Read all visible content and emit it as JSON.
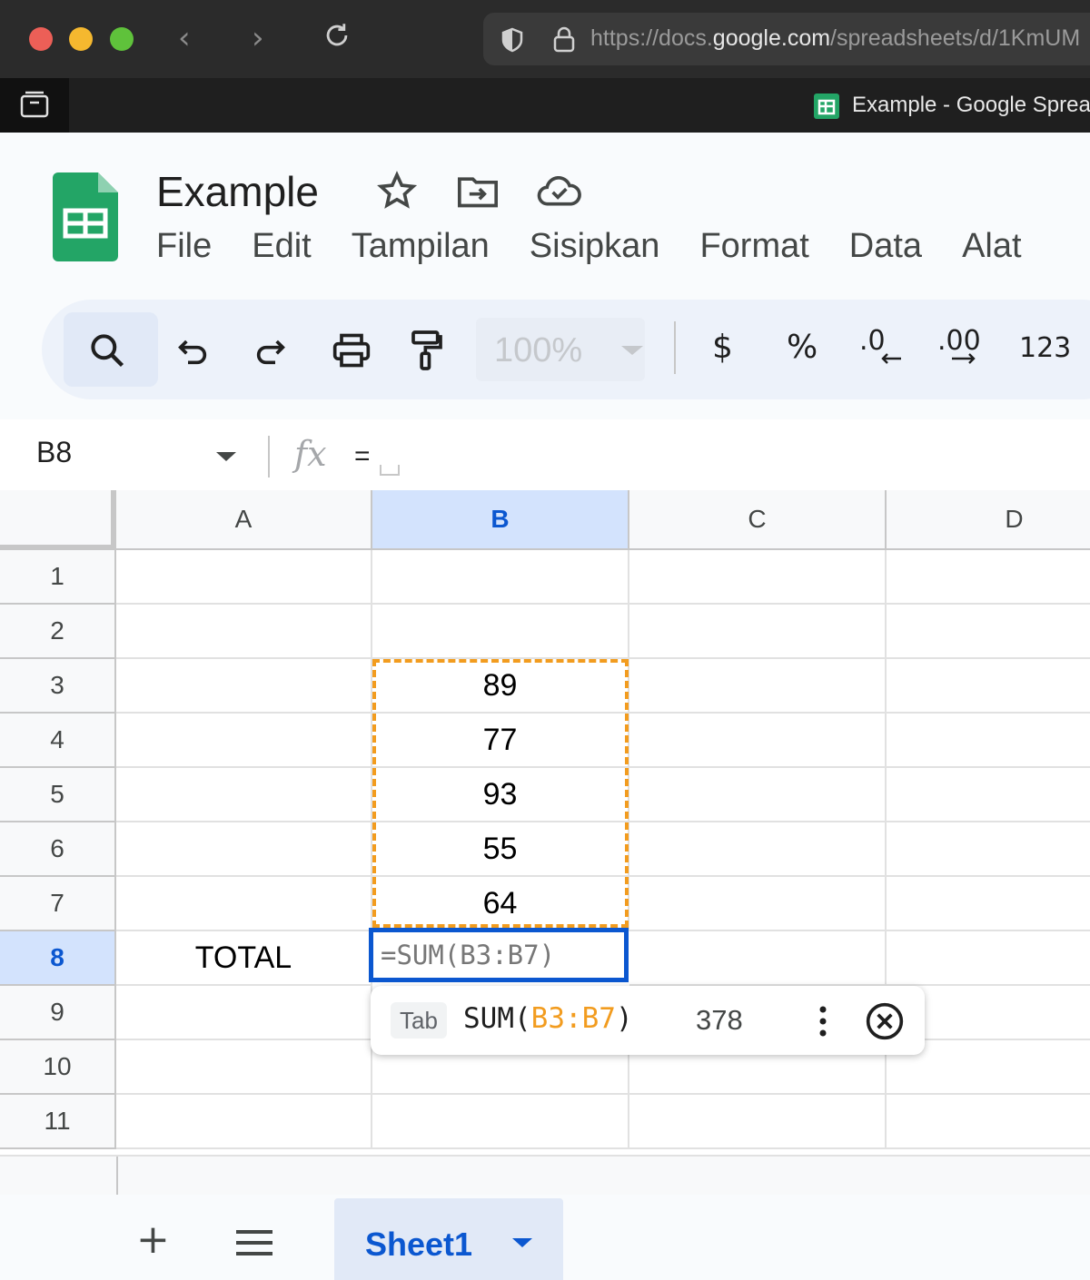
{
  "browser": {
    "url_prefix": "https://docs.",
    "url_host": "google.com",
    "url_path": "/spreadsheets/d/1KmUM",
    "tab_title": "Example - Google Sprea",
    "icons": [
      "back-icon",
      "forward-icon",
      "reload-icon",
      "shield-icon",
      "lock-icon",
      "sidebar-icon"
    ]
  },
  "header": {
    "title": "Example",
    "menu": [
      "File",
      "Edit",
      "Tampilan",
      "Sisipkan",
      "Format",
      "Data",
      "Alat"
    ],
    "icons": [
      "star-icon",
      "move-to-folder-icon",
      "cloud-saved-icon"
    ]
  },
  "toolbar": {
    "zoom": "100%",
    "currency": "$",
    "percent": "%",
    "decrease_decimal": ".0",
    "increase_decimal": ".00",
    "number_format": "123"
  },
  "formula_bar": {
    "cell_ref": "B8",
    "fx": "fx",
    "value": "="
  },
  "grid": {
    "columns": [
      "A",
      "B",
      "C",
      "D"
    ],
    "rows": [
      "1",
      "2",
      "3",
      "4",
      "5",
      "6",
      "7",
      "8",
      "9",
      "10",
      "11"
    ],
    "b_values": {
      "3": "89",
      "4": "77",
      "5": "93",
      "6": "55",
      "7": "64"
    },
    "a8": "TOTAL",
    "active_cell_text": "=SUM(B3:B7)"
  },
  "suggestion": {
    "key_hint": "Tab",
    "fn_prefix": "SUM(",
    "fn_range": "B3:B7",
    "fn_suffix": ")",
    "result": "378"
  },
  "sheets": {
    "add": "+",
    "active_tab": "Sheet1"
  },
  "colors": {
    "accent": "#0b57d0",
    "range_highlight": "#f29c1f",
    "sheets_green": "#23a566"
  }
}
